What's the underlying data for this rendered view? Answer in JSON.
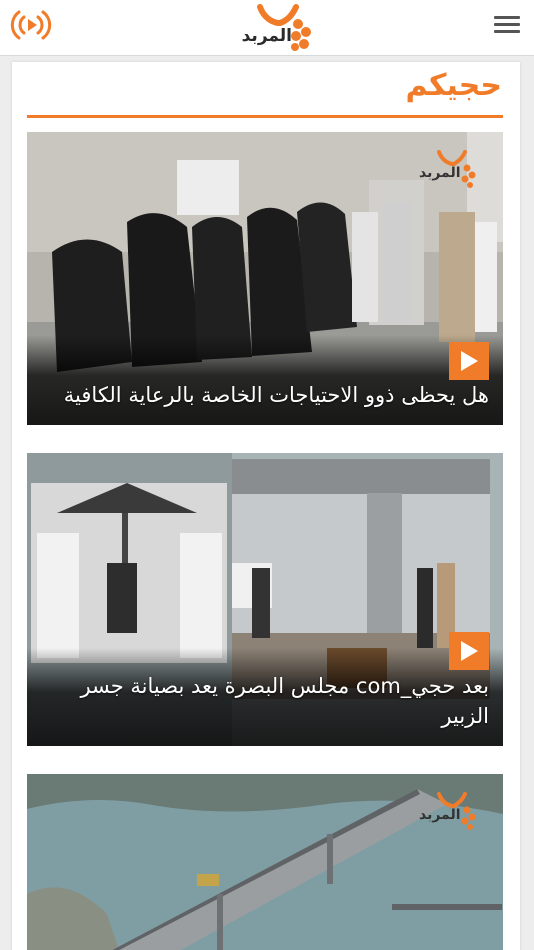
{
  "header": {
    "logo_text": "المربد",
    "radio_icon": "broadcast-icon",
    "menu_icon": "hamburger-menu-icon"
  },
  "section": {
    "title": "حجيكم"
  },
  "items": [
    {
      "caption": "هل يحظى ذوو الاحتياجات الخاصة بالرعاية الكافية",
      "watermark": "المربد"
    },
    {
      "caption": "بعد حجي_com مجلس البصرة يعد بصيانة جسر الزبير",
      "watermark": ""
    },
    {
      "caption": "",
      "watermark": "المربد"
    }
  ],
  "colors": {
    "accent": "#f07c2a",
    "header_bg": "#ffffff",
    "page_bg": "#ededed"
  }
}
